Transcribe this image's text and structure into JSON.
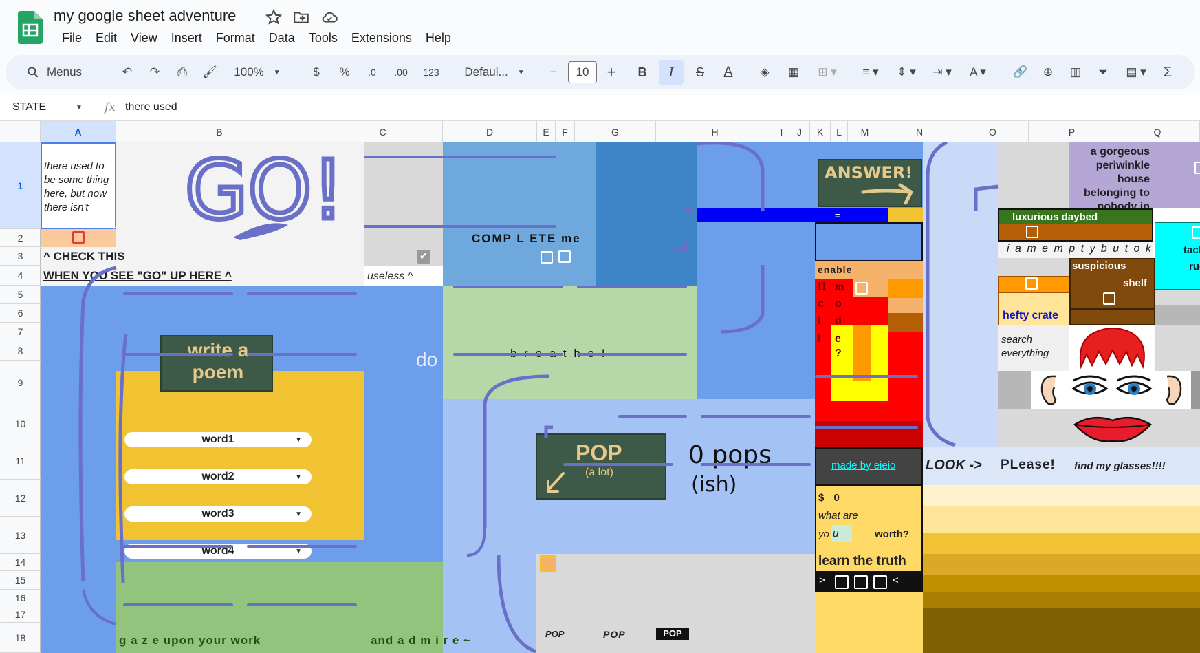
{
  "app": {
    "title": "my google sheet adventure"
  },
  "menu": [
    "File",
    "Edit",
    "View",
    "Insert",
    "Format",
    "Data",
    "Tools",
    "Extensions",
    "Help"
  ],
  "toolbar": {
    "search": "Menus",
    "zoom": "100%",
    "currency": "$",
    "percent": "%",
    "dec_minus": ".0",
    "dec_plus": ".00",
    "format123": "123",
    "font": "Defaul...",
    "font_size": "10",
    "bold": "B",
    "italic": "I",
    "strike": "S",
    "textcolor": "A",
    "minus": "−",
    "plus": "+",
    "sigma": "Σ"
  },
  "formula": {
    "namebox": "STATE",
    "fx": "fx",
    "value": "there used"
  },
  "columns": [
    "A",
    "B",
    "C",
    "D",
    "E",
    "F",
    "G",
    "H",
    "I",
    "J",
    "K",
    "L",
    "M",
    "N",
    "O",
    "P",
    "Q"
  ],
  "rows": [
    "1",
    "2",
    "3",
    "4",
    "5",
    "6",
    "7",
    "8",
    "9",
    "10",
    "11",
    "12",
    "13",
    "14",
    "15",
    "16",
    "17",
    "18"
  ],
  "cells": {
    "a1": "there used to be some thing here, but now there isn't",
    "a3": "^ CHECK THIS",
    "a4": "WHEN YOU SEE \"GO\" UP HERE ^",
    "go": "GO!",
    "c4": "useless ^",
    "complete": "COMP L ETE  me",
    "answer": "ANSWER!",
    "equals": "=",
    "breathe": "b r e a t  h  e !",
    "do": "do",
    "write_poem": "write a poem",
    "words": [
      "word1",
      "word2",
      "word3",
      "word4"
    ],
    "gaze": "g a z e upon your work",
    "admire": "and a d m i r e ~",
    "pop": "POP",
    "pop_alot": "(a lot)",
    "pops": "0 pops",
    "ish": "(ish)",
    "pop_small": [
      "POP",
      "POP",
      "POP"
    ],
    "enable": "enable",
    "hmm": [
      "H",
      "m"
    ],
    "column_letters": [
      "c",
      "o",
      "l",
      "d",
      "l",
      "e",
      "?"
    ],
    "made_by": "made by eieio",
    "look": "LOOK ->",
    "please": "PLease!",
    "glasses": "find my glasses!!!!",
    "s0": "$ 0",
    "worth1": "what are",
    "worth2": "yo",
    "worth_u": "u",
    "worth3": "worth?",
    "learn": "learn the truth",
    "gt": ">",
    "lt": "<",
    "periwinkle": "a gorgeous periwinkle house belonging to nobody in particular",
    "daybed": "luxurious  daybed",
    "empty": "i a m e m p t y b u t o k",
    "shelf1": "suspicious",
    "shelf2": "shelf",
    "crate": "hefty crate",
    "tacky1": "tacky",
    "tacky2": "rug",
    "search": "search everything"
  },
  "colors": {
    "blue": "#6d9eeb",
    "light_blue": "#a4c2f4",
    "green": "#b6d7a8",
    "yellow": "#f1c232",
    "chalk": "#3d5a48",
    "purple_line": "#6a70c8",
    "cyan": "#00ffff",
    "brown": "#b45f06"
  }
}
